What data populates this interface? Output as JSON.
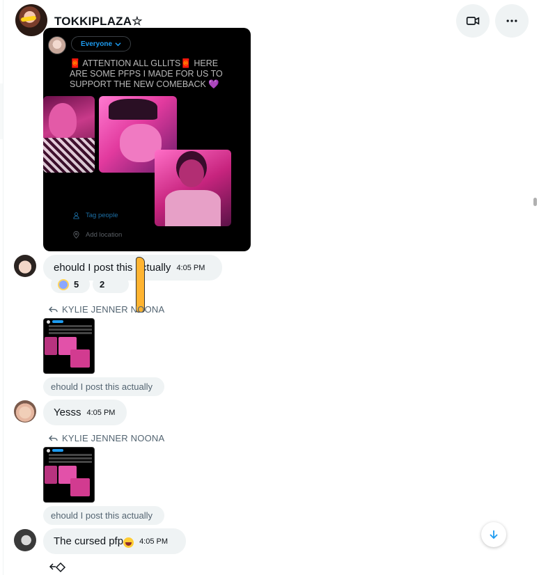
{
  "header": {
    "title": "TOKKIPLAZA☆",
    "video_icon": "video-camera-icon",
    "more_icon": "more-horizontal-icon"
  },
  "shared_image": {
    "audience_label": "Everyone",
    "caption": "🧧 ATTENTION ALL GLLITS🧧 HERE ARE SOME PFPS I MADE FOR US TO SUPPORT THE NEW COMEBACK 💜",
    "tag_people": "Tag people",
    "add_location": "Add location"
  },
  "messages": [
    {
      "text": "ehould I post this actually",
      "time": "4:05 PM",
      "reactions": [
        {
          "emoji": "scream-emoji",
          "count": "5"
        },
        {
          "emoji": "thumbs-up-emoji",
          "count": "2"
        }
      ]
    },
    {
      "reply_to": "KYLIE JENNER NOONA",
      "quoted_text": "ehould I post this actually",
      "text": "Yesss",
      "time": "4:05 PM"
    },
    {
      "reply_to": "KYLIE JENNER NOONA",
      "quoted_text": "ehould I post this actually",
      "text": "The cursed pfp",
      "time": "4:05 PM"
    }
  ],
  "colors": {
    "bubble_bg": "#eff3f4",
    "accent": "#1d9bf0",
    "muted_text": "#536471"
  }
}
